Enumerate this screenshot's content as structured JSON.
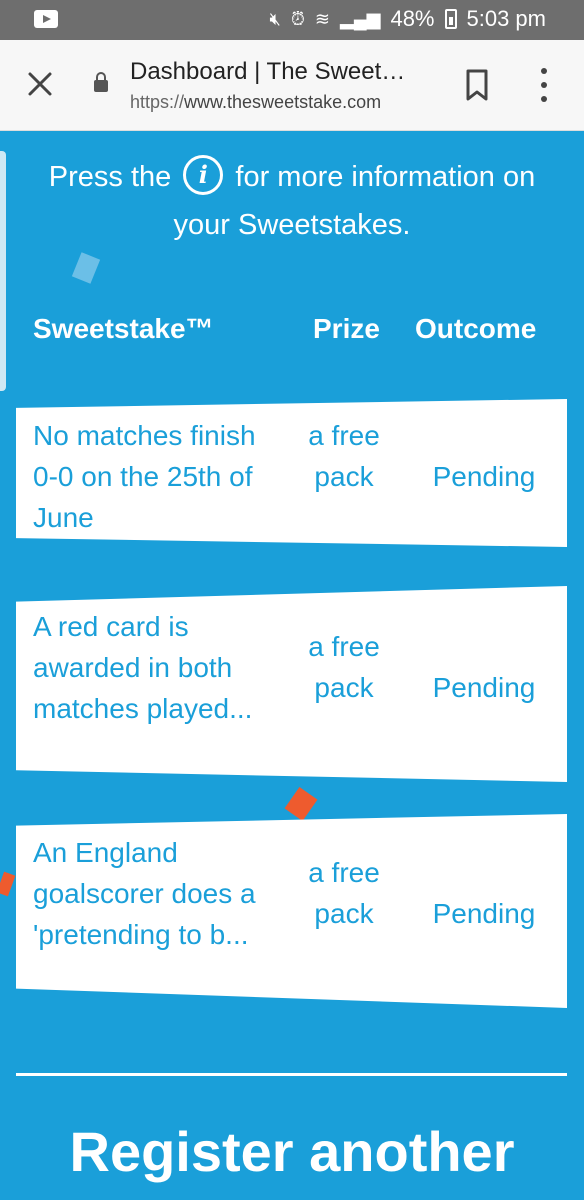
{
  "status_bar": {
    "battery": "48%",
    "time": "5:03 pm",
    "icons": [
      "youtube-icon",
      "mute-icon",
      "alarm-icon",
      "wifi-icon",
      "signal-icon",
      "battery-icon"
    ]
  },
  "browser": {
    "title": "Dashboard | The Sweet…",
    "url_scheme": "https://",
    "url_host": "www.thesweetstake.com"
  },
  "info": {
    "before": "Press the",
    "icon_glyph": "i",
    "after": "for more information on your Sweetstakes."
  },
  "table": {
    "headers": {
      "name": "Sweetstake™",
      "prize": "Prize",
      "outcome": "Outcome"
    },
    "rows": [
      {
        "name": "No matches finish 0-0 on the 25th of June",
        "prize": "a free pack",
        "outcome": "Pending"
      },
      {
        "name": "A red card is awarded in both matches played...",
        "prize": "a free pack",
        "outcome": "Pending"
      },
      {
        "name": "An England goalscorer does a 'pretending to b...",
        "prize": "a free pack",
        "outcome": "Pending"
      }
    ]
  },
  "register": {
    "heading": "Register another"
  },
  "colors": {
    "brand_blue": "#1a9fd9",
    "confetti_orange": "#ee5b2e",
    "status_bar": "#6e6e6e"
  }
}
